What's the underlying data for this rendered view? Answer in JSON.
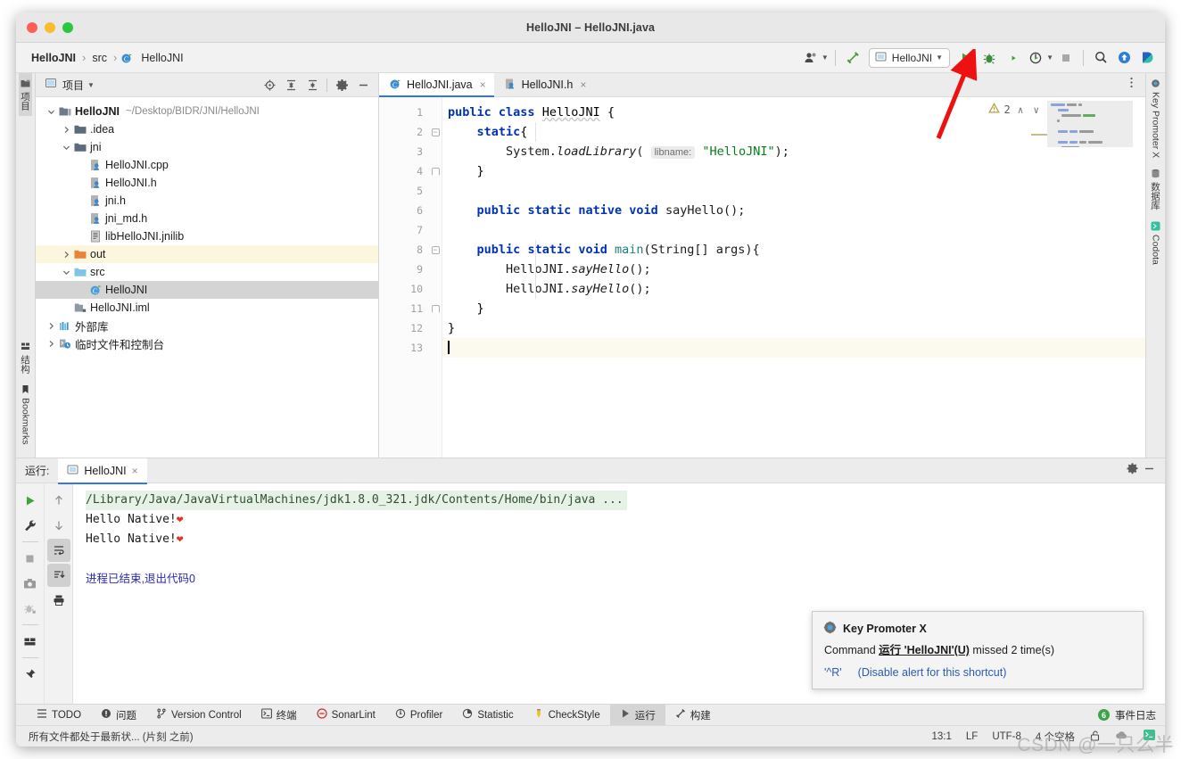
{
  "window": {
    "title": "HelloJNI – HelloJNI.java"
  },
  "breadcrumb": {
    "items": [
      "HelloJNI",
      "src",
      "HelloJNI"
    ],
    "separator": "›"
  },
  "toolbar": {
    "profile_icon": "user-profile-icon",
    "build_icon": "build-hammer-icon",
    "run_config_name": "HelloJNI",
    "run_icon": "run-icon",
    "debug_icon": "debug-icon",
    "run_coverage_icon": "run-with-coverage-icon",
    "profile_run_icon": "profile-icon",
    "stop_icon": "stop-icon",
    "search_icon": "search-everywhere-icon",
    "update_icon": "update-project-icon",
    "codota_icon": "codota-icon"
  },
  "project_panel": {
    "title": "项目",
    "actions": [
      "locate-icon",
      "expand-all-icon",
      "collapse-all-icon",
      "settings-icon",
      "hide-icon"
    ],
    "tree": [
      {
        "label": "HelloJNI",
        "path": "~/Desktop/BIDR/JNI/HelloJNI",
        "depth": 0,
        "arrow": "down",
        "icon": "module-folder-icon",
        "bold": true,
        "state": "normal"
      },
      {
        "label": ".idea",
        "path": "",
        "depth": 1,
        "arrow": "right",
        "icon": "folder-icon",
        "bold": false,
        "state": "normal"
      },
      {
        "label": "jni",
        "path": "",
        "depth": 1,
        "arrow": "down",
        "icon": "folder-icon",
        "bold": false,
        "state": "normal"
      },
      {
        "label": "HelloJNI.cpp",
        "path": "",
        "depth": 2,
        "arrow": "none",
        "icon": "cpp-file-icon",
        "bold": false,
        "state": "normal"
      },
      {
        "label": "HelloJNI.h",
        "path": "",
        "depth": 2,
        "arrow": "none",
        "icon": "header-file-icon",
        "bold": false,
        "state": "normal"
      },
      {
        "label": "jni.h",
        "path": "",
        "depth": 2,
        "arrow": "none",
        "icon": "header-file-icon",
        "bold": false,
        "state": "normal"
      },
      {
        "label": "jni_md.h",
        "path": "",
        "depth": 2,
        "arrow": "none",
        "icon": "header-file-icon",
        "bold": false,
        "state": "normal"
      },
      {
        "label": "libHelloJNI.jnilib",
        "path": "",
        "depth": 2,
        "arrow": "none",
        "icon": "binary-file-icon",
        "bold": false,
        "state": "normal"
      },
      {
        "label": "out",
        "path": "",
        "depth": 1,
        "arrow": "right",
        "icon": "output-folder-icon",
        "bold": false,
        "state": "highlight"
      },
      {
        "label": "src",
        "path": "",
        "depth": 1,
        "arrow": "down",
        "icon": "source-folder-icon",
        "bold": false,
        "state": "normal"
      },
      {
        "label": "HelloJNI",
        "path": "",
        "depth": 2,
        "arrow": "none",
        "icon": "java-class-icon",
        "bold": false,
        "state": "selected"
      },
      {
        "label": "HelloJNI.iml",
        "path": "",
        "depth": 1,
        "arrow": "none",
        "icon": "iml-file-icon",
        "bold": false,
        "state": "normal"
      },
      {
        "label": "外部库",
        "path": "",
        "depth": 0,
        "arrow": "right",
        "icon": "libraries-icon",
        "bold": false,
        "state": "normal"
      },
      {
        "label": "临时文件和控制台",
        "path": "",
        "depth": 0,
        "arrow": "right",
        "icon": "scratches-icon",
        "bold": false,
        "state": "normal"
      }
    ]
  },
  "left_strip": {
    "tools": [
      {
        "label": "项目",
        "icon": "project-icon",
        "active": true
      },
      {
        "label": "结构",
        "icon": "structure-icon",
        "active": false
      },
      {
        "label": "Bookmarks",
        "icon": "bookmarks-icon",
        "active": false
      }
    ]
  },
  "right_strip": {
    "tools": [
      {
        "label": "Key Promoter X",
        "icon": "key-promoter-icon"
      },
      {
        "label": "数据库",
        "icon": "database-icon"
      },
      {
        "label": "Codota",
        "icon": "codota-icon"
      }
    ]
  },
  "editor": {
    "tabs": [
      {
        "label": "HelloJNI.java",
        "icon": "java-class-icon",
        "active": true,
        "close": "×"
      },
      {
        "label": "HelloJNI.h",
        "icon": "header-file-icon",
        "active": false,
        "close": "×"
      }
    ],
    "more_icon": "more-options-icon",
    "warning_count": "2",
    "warning_icon": "warning-triangle-icon",
    "nav_up": "∧",
    "nav_down": "∨",
    "lines": [
      {
        "n": "1",
        "gutter_icon": "run-gutter-icon",
        "fold": "none",
        "current": false
      },
      {
        "n": "2",
        "gutter_icon": "",
        "fold": "open",
        "current": false
      },
      {
        "n": "3",
        "gutter_icon": "",
        "fold": "none",
        "current": false
      },
      {
        "n": "4",
        "gutter_icon": "",
        "fold": "close",
        "current": false
      },
      {
        "n": "5",
        "gutter_icon": "",
        "fold": "none",
        "current": false
      },
      {
        "n": "6",
        "gutter_icon": "",
        "fold": "none",
        "current": false
      },
      {
        "n": "7",
        "gutter_icon": "",
        "fold": "none",
        "current": false
      },
      {
        "n": "8",
        "gutter_icon": "run-gutter-icon",
        "fold": "open",
        "current": false
      },
      {
        "n": "9",
        "gutter_icon": "",
        "fold": "none",
        "current": false
      },
      {
        "n": "10",
        "gutter_icon": "",
        "fold": "none",
        "current": false
      },
      {
        "n": "11",
        "gutter_icon": "",
        "fold": "close",
        "current": false
      },
      {
        "n": "12",
        "gutter_icon": "",
        "fold": "none",
        "current": false
      },
      {
        "n": "13",
        "gutter_icon": "",
        "fold": "none",
        "current": true
      }
    ],
    "code_text": [
      "public class HelloJNI {",
      "    static{",
      "        System.loadLibrary( libname: \"HelloJNI\");",
      "    }",
      "",
      "    public static native void sayHello();",
      "",
      "    public static void main(String[] args){",
      "        HelloJNI.sayHello();",
      "        HelloJNI.sayHello();",
      "    }",
      "}",
      ""
    ],
    "param_hint": "libname:"
  },
  "console": {
    "label": "运行:",
    "tab_label": "HelloJNI",
    "tab_icon": "run-config-icon",
    "tab_close": "×",
    "settings_icon": "settings-icon",
    "minimize_icon": "minimize-icon",
    "left_buttons": [
      "rerun-icon",
      "wrench-icon",
      "stop-icon",
      "camera-icon",
      "dump-threads-icon",
      "layout-icon",
      "pin-icon"
    ],
    "right_buttons": [
      "scroll-up-icon",
      "scroll-down-icon",
      "soft-wrap-icon",
      "scroll-to-end-icon",
      "print-icon"
    ],
    "output": [
      {
        "text": "/Library/Java/JavaVirtualMachines/jdk1.8.0_321.jdk/Contents/Home/bin/java ...",
        "style": "cmd"
      },
      {
        "text": "Hello Native!",
        "style": "normal",
        "emoji": "❤"
      },
      {
        "text": "Hello Native!",
        "style": "normal",
        "emoji": "❤"
      },
      {
        "text": "",
        "style": "normal"
      },
      {
        "text": "进程已结束,退出代码0",
        "style": "exit"
      }
    ]
  },
  "notification": {
    "icon": "key-promoter-icon",
    "title": "Key Promoter X",
    "command_prefix": "Command ",
    "command_name": "运行 'HelloJNI'(U)",
    "command_suffix": " missed 2 time(s)",
    "shortcut": "'^R'",
    "disable_link": "(Disable alert for this shortcut)"
  },
  "bottom_bar": {
    "items": [
      {
        "label": "TODO",
        "icon": "todo-icon",
        "active": false
      },
      {
        "label": "问题",
        "icon": "problems-icon",
        "active": false
      },
      {
        "label": "Version Control",
        "icon": "vcs-icon",
        "active": false
      },
      {
        "label": "终端",
        "icon": "terminal-icon",
        "active": false
      },
      {
        "label": "SonarLint",
        "icon": "sonarlint-icon",
        "active": false
      },
      {
        "label": "Profiler",
        "icon": "profiler-icon",
        "active": false
      },
      {
        "label": "Statistic",
        "icon": "statistic-icon",
        "active": false
      },
      {
        "label": "CheckStyle",
        "icon": "checkstyle-icon",
        "active": false
      },
      {
        "label": "运行",
        "icon": "run-icon",
        "active": true
      },
      {
        "label": "构建",
        "icon": "build-icon",
        "active": false
      }
    ],
    "event_log": {
      "label": "事件日志",
      "count": "6"
    }
  },
  "status_bar": {
    "message": "所有文件都处于最新状... (片刻 之前)",
    "caret_position": "13:1",
    "line_separator": "LF",
    "encoding": "UTF-8",
    "indent": "4 个空格",
    "lock_icon": "unlocked-icon",
    "backup_icon": "cloud-icon",
    "terminal_icon": "terminal-status-icon"
  },
  "annotation": {
    "arrow_color": "#ee1111"
  },
  "watermark": "CSDN @一只么半"
}
